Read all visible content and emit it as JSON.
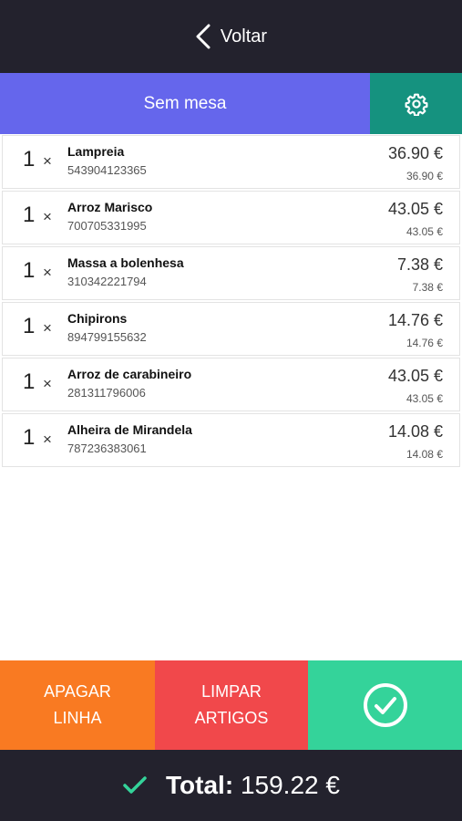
{
  "header": {
    "back_label": "Voltar"
  },
  "table": {
    "label": "Sem mesa"
  },
  "items": [
    {
      "qty": "1",
      "name": "Lampreia",
      "code": "543904123365",
      "price": "36.90 €",
      "unit_price": "36.90 €"
    },
    {
      "qty": "1",
      "name": "Arroz Marisco",
      "code": "700705331995",
      "price": "43.05 €",
      "unit_price": "43.05 €"
    },
    {
      "qty": "1",
      "name": "Massa a bolenhesa",
      "code": "310342221794",
      "price": "7.38 €",
      "unit_price": "7.38 €"
    },
    {
      "qty": "1",
      "name": "Chipirons",
      "code": "894799155632",
      "price": "14.76 €",
      "unit_price": "14.76 €"
    },
    {
      "qty": "1",
      "name": "Arroz de carabineiro",
      "code": "281311796006",
      "price": "43.05 €",
      "unit_price": "43.05 €"
    },
    {
      "qty": "1",
      "name": "Alheira de Mirandela",
      "code": "787236383061",
      "price": "14.08 €",
      "unit_price": "14.08 €"
    }
  ],
  "times_symbol": "×",
  "actions": {
    "delete_line": [
      "APAGAR",
      "LINHA"
    ],
    "clear_items": [
      "LIMPAR",
      "ARTIGOS"
    ]
  },
  "footer": {
    "total_label": "Total:",
    "total_value": "159.22 €"
  },
  "colors": {
    "dark": "#23222d",
    "table": "#6566ec",
    "settings": "#15927f",
    "delete": "#f97a22",
    "clear": "#f1484b",
    "confirm": "#34d39a",
    "check": "#34d39a"
  }
}
